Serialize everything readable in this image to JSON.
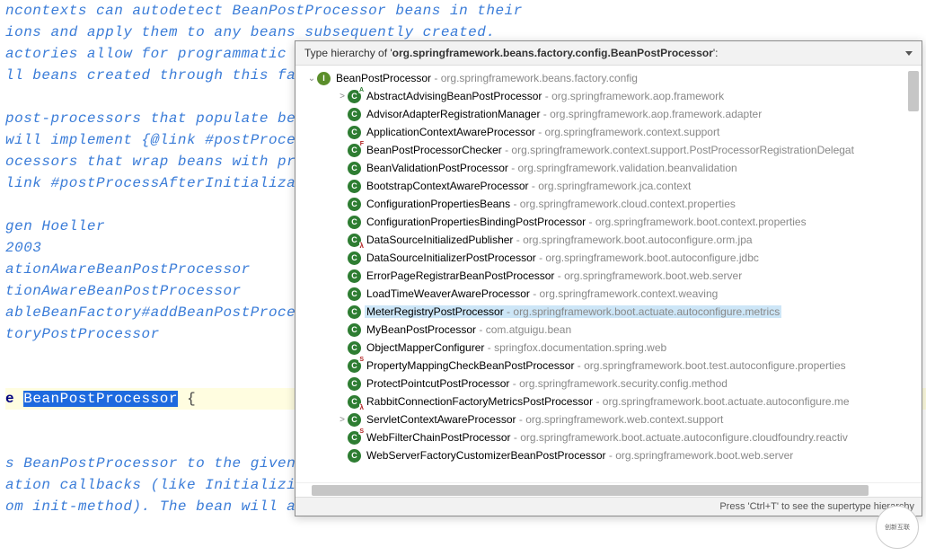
{
  "editor_lines": [
    {
      "cls": "cm",
      "text": "ncontexts can autodetect BeanPostProcessor beans in their"
    },
    {
      "cls": "cm",
      "text": "ions and apply them to any beans subsequently created."
    },
    {
      "cls": "cm",
      "text": "actories allow for programmatic registration of"
    },
    {
      "cls": "cm",
      "text": "ll beans created through this factory."
    },
    {
      "cls": "cm",
      "text": ""
    },
    {
      "cls": "cm",
      "text": " post-processors that populate beans via marker"
    },
    {
      "cls": "cm",
      "text": "will implement {@link #postProcessBeforeInitialization},"
    },
    {
      "cls": "cm",
      "text": "ocessors that wrap beans with proxies will normally"
    },
    {
      "cls": "cm",
      "text": "link #postProcessAfterInitialization}."
    },
    {
      "cls": "cm",
      "text": ""
    },
    {
      "cls": "cm",
      "text": "gen Hoeller"
    },
    {
      "cls": "cm",
      "text": " 2003"
    },
    {
      "cls": "cm",
      "text": "ationAwareBeanPostProcessor"
    },
    {
      "cls": "cm",
      "text": "tionAwareBeanPostProcessor"
    },
    {
      "cls": "cm",
      "text": "ableBeanFactory#addBeanPostProcessor"
    },
    {
      "cls": "cm",
      "text": "toryPostProcessor"
    },
    {
      "cls": "cm",
      "text": ""
    },
    {
      "cls": "cm",
      "text": ""
    },
    {
      "cls": "hl",
      "html": "<span class='kw'>e</span> <span class='sel'>BeanPostProcessor</span>  <span class='br'>{</span>"
    },
    {
      "cls": "cm",
      "text": ""
    },
    {
      "cls": "cm",
      "text": ""
    },
    {
      "cls": "cm",
      "text": "s BeanPostProcessor to the given new bean instance"
    },
    {
      "cls": "cm",
      "text": "ation callbacks (like InitializingBean's {@code afterPropertiesSet"
    },
    {
      "cls": "cm",
      "text": "om init-method). The bean will already be populated with property v"
    }
  ],
  "popup": {
    "title_prefix": "Type hierarchy of '",
    "title_class": "org.springframework.beans.factory.config.BeanPostProcessor",
    "title_suffix": "':",
    "footer": "Press 'Ctrl+T' to see the supertype hierarchy",
    "root": {
      "name": "BeanPostProcessor",
      "pkg": "org.springframework.beans.factory.config",
      "icon": "iface",
      "expanded": true
    },
    "children": [
      {
        "name": "AbstractAdvisingBeanPostProcessor",
        "pkg": "org.springframework.aop.framework",
        "icon": "cls abs",
        "arrow": ">"
      },
      {
        "name": "AdvisorAdapterRegistrationManager",
        "pkg": "org.springframework.aop.framework.adapter",
        "icon": "cls"
      },
      {
        "name": "ApplicationContextAwareProcessor",
        "pkg": "org.springframework.context.support",
        "icon": "cls"
      },
      {
        "name": "BeanPostProcessorChecker",
        "pkg": "org.springframework.context.support.PostProcessorRegistrationDelegat",
        "icon": "cls fin"
      },
      {
        "name": "BeanValidationPostProcessor",
        "pkg": "org.springframework.validation.beanvalidation",
        "icon": "cls"
      },
      {
        "name": "BootstrapContextAwareProcessor",
        "pkg": "org.springframework.jca.context",
        "icon": "cls"
      },
      {
        "name": "ConfigurationPropertiesBeans",
        "pkg": "org.springframework.cloud.context.properties",
        "icon": "cls"
      },
      {
        "name": "ConfigurationPropertiesBindingPostProcessor",
        "pkg": "org.springframework.boot.context.properties",
        "icon": "cls"
      },
      {
        "name": "DataSourceInitializedPublisher",
        "pkg": "org.springframework.boot.autoconfigure.orm.jpa",
        "icon": "cls lam"
      },
      {
        "name": "DataSourceInitializerPostProcessor",
        "pkg": "org.springframework.boot.autoconfigure.jdbc",
        "icon": "cls"
      },
      {
        "name": "ErrorPageRegistrarBeanPostProcessor",
        "pkg": "org.springframework.boot.web.server",
        "icon": "cls"
      },
      {
        "name": "LoadTimeWeaverAwareProcessor",
        "pkg": "org.springframework.context.weaving",
        "icon": "cls"
      },
      {
        "name": "MeterRegistryPostProcessor",
        "pkg": "org.springframework.boot.actuate.autoconfigure.metrics",
        "icon": "cls",
        "selected": true
      },
      {
        "name": "MyBeanPostProcessor",
        "pkg": "com.atguigu.bean",
        "icon": "cls"
      },
      {
        "name": "ObjectMapperConfigurer",
        "pkg": "springfox.documentation.spring.web",
        "icon": "cls"
      },
      {
        "name": "PropertyMappingCheckBeanPostProcessor",
        "pkg": "org.springframework.boot.test.autoconfigure.properties",
        "icon": "cls stat"
      },
      {
        "name": "ProtectPointcutPostProcessor",
        "pkg": "org.springframework.security.config.method",
        "icon": "cls"
      },
      {
        "name": "RabbitConnectionFactoryMetricsPostProcessor",
        "pkg": "org.springframework.boot.actuate.autoconfigure.me",
        "icon": "cls lam"
      },
      {
        "name": "ServletContextAwareProcessor",
        "pkg": "org.springframework.web.context.support",
        "icon": "cls",
        "arrow": ">"
      },
      {
        "name": "WebFilterChainPostProcessor",
        "pkg": "org.springframework.boot.actuate.autoconfigure.cloudfoundry.reactiv",
        "icon": "cls stat"
      },
      {
        "name": "WebServerFactoryCustomizerBeanPostProcessor",
        "pkg": "org.springframework.boot.web.server",
        "icon": "cls"
      }
    ]
  },
  "watermark": "创新互联"
}
